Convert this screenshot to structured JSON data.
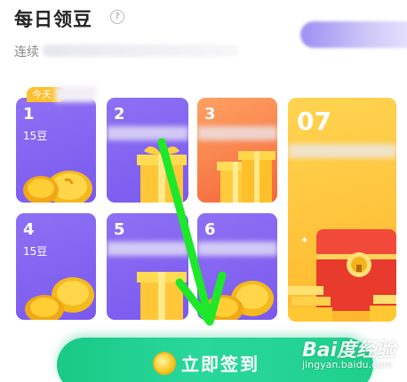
{
  "header": {
    "title": "每日领豆",
    "help_symbol": "?",
    "subtitle_prefix": "连续"
  },
  "days": [
    {
      "num": "1",
      "reward": "15豆",
      "badge": "今天"
    },
    {
      "num": "2"
    },
    {
      "num": "3"
    },
    {
      "num": "07"
    },
    {
      "num": "4",
      "reward": "15豆"
    },
    {
      "num": "5"
    },
    {
      "num": "6"
    }
  ],
  "sign_button": {
    "label": "立即签到",
    "icon": "coin-icon"
  },
  "watermark": {
    "main": "Bai度经验",
    "sub": "jingyan.baidu.com"
  },
  "colors": {
    "purple_card": "#7a59ee",
    "orange_card": "#f4683c",
    "gold_card": "#ffb72b",
    "button_green": "#1fd08c",
    "annotation_arrow": "#1de82a"
  }
}
